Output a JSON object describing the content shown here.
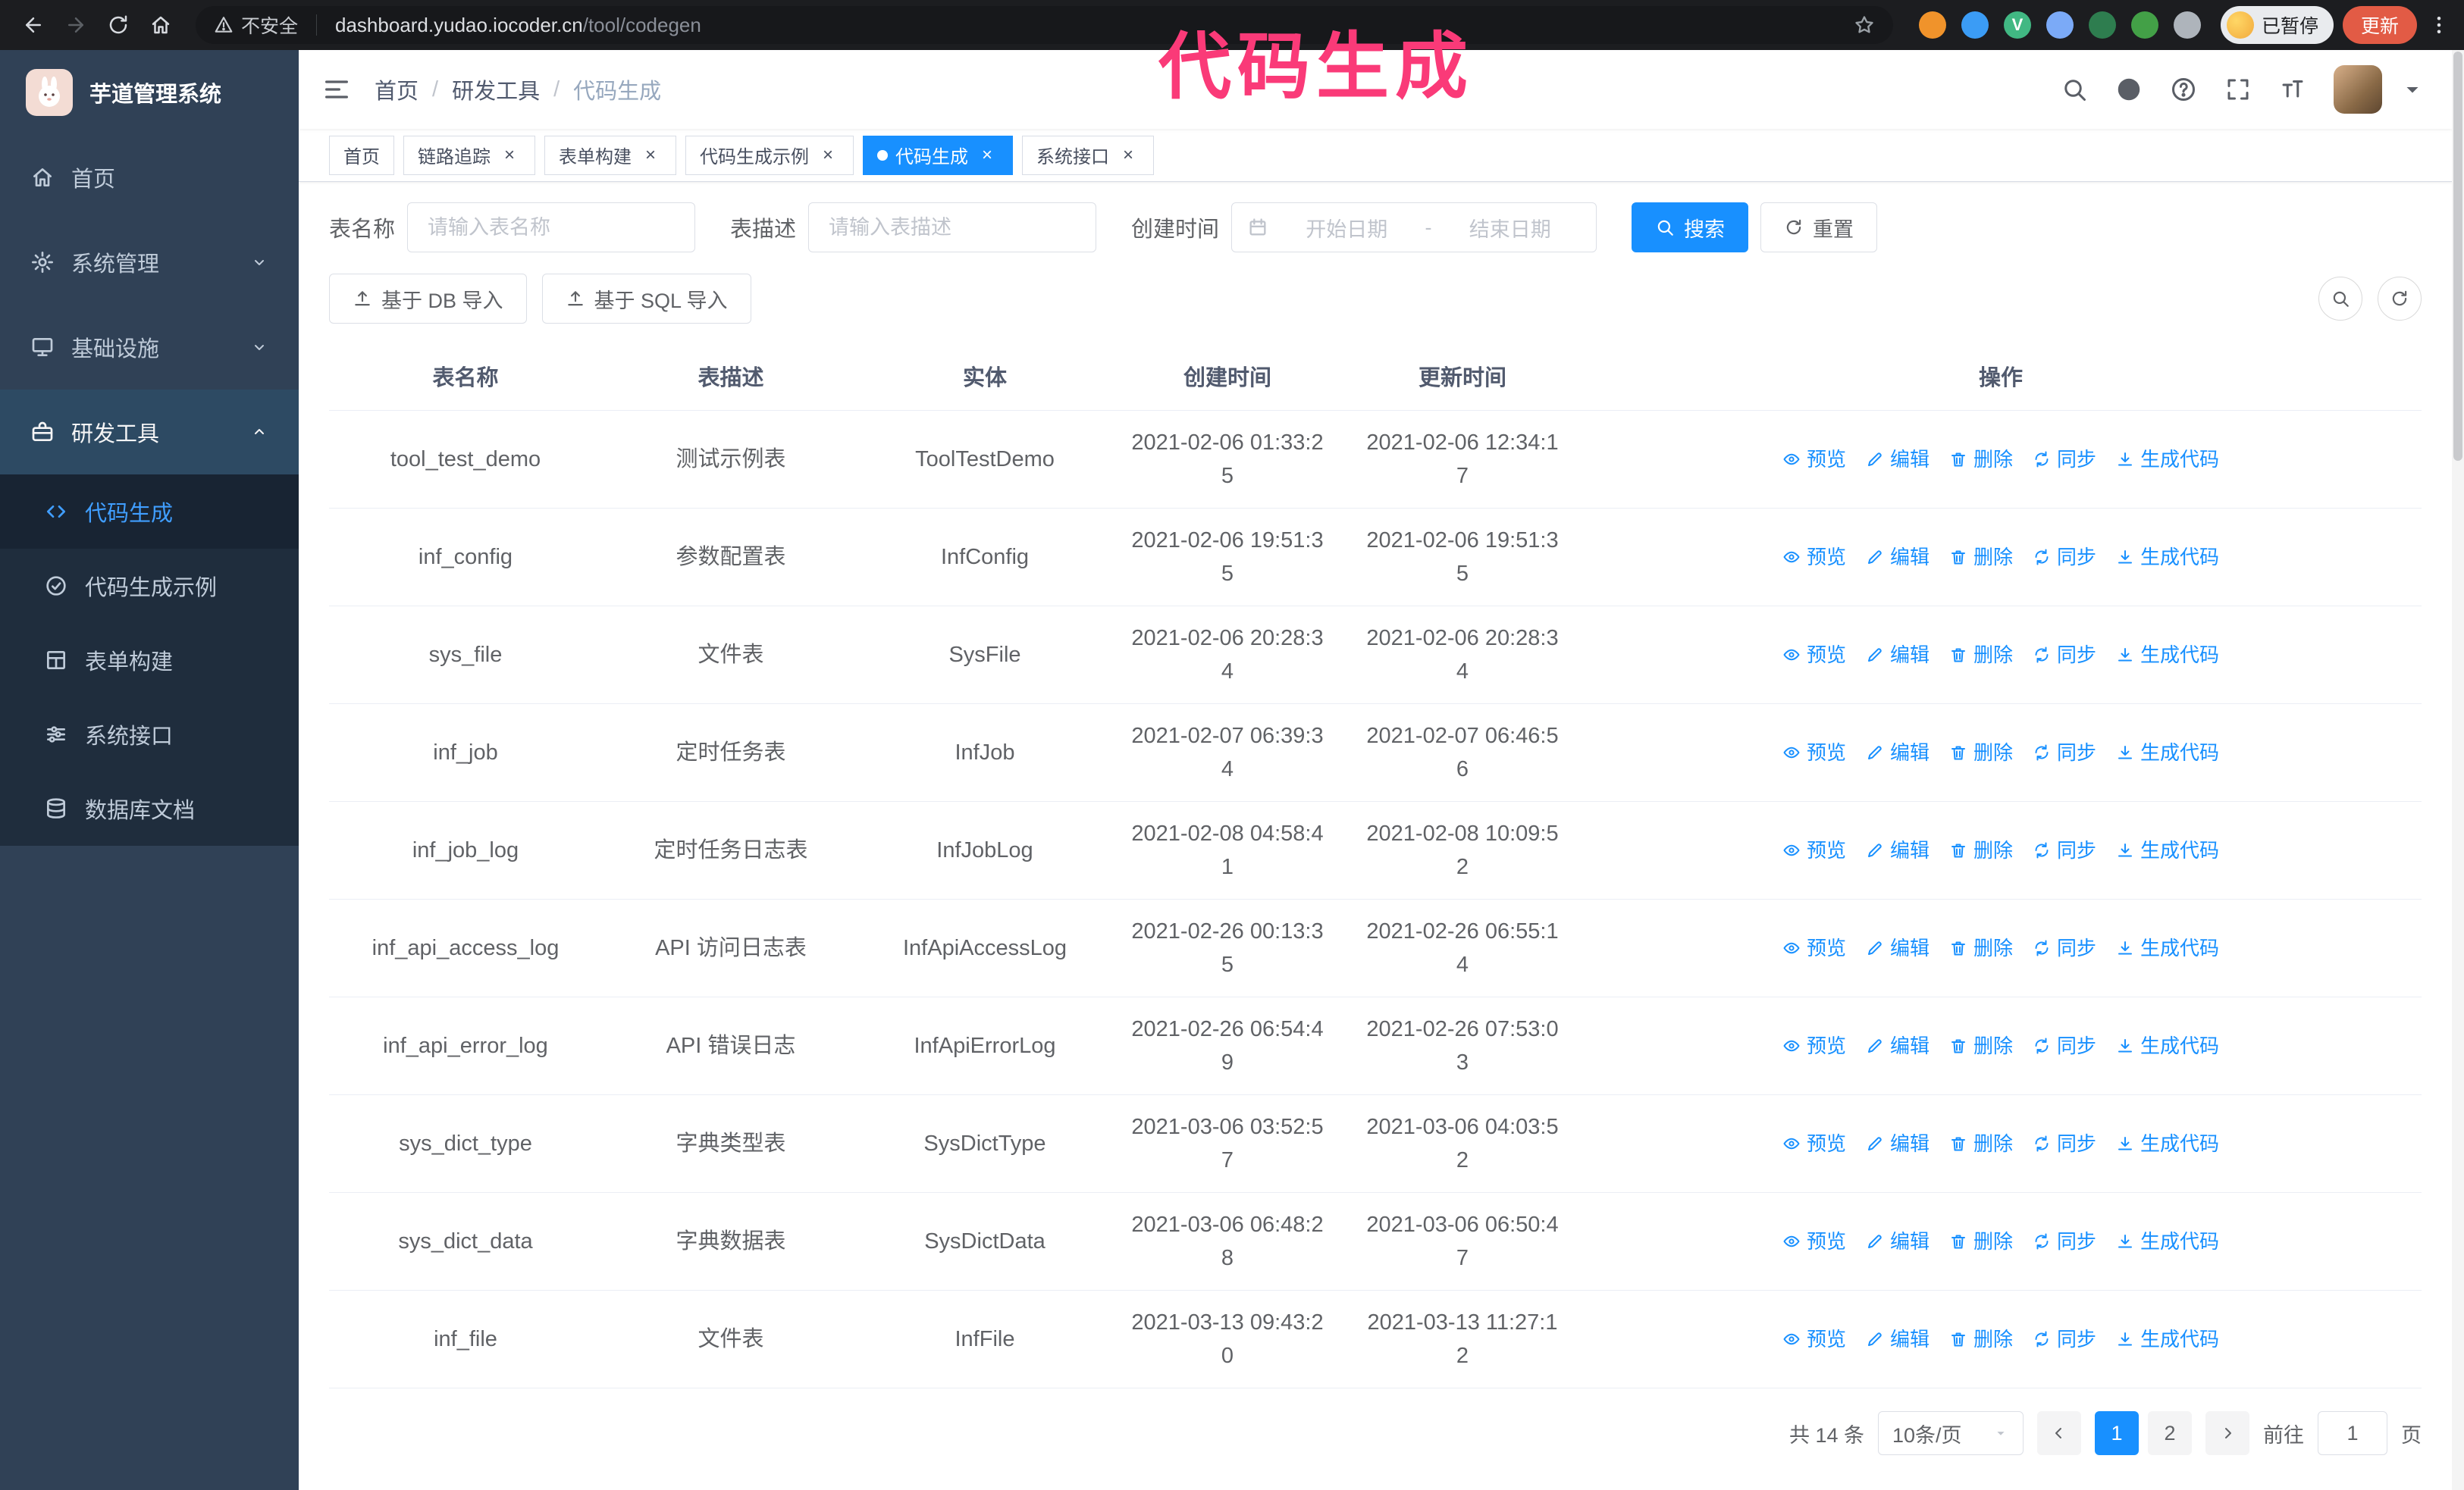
{
  "colors": {
    "accent": "#1890ff",
    "annotation_pink": "#fa3a78",
    "sidebar_bg": "#304156",
    "submenu_bg": "#1f2d3d",
    "active_menu_text": "#409eff",
    "update_button_bg": "#e25b45"
  },
  "annotation": "代码生成",
  "browser": {
    "security_label": "不安全",
    "url_domain": "dashboard.yudao.iocoder.cn",
    "url_path": "/tool/codegen",
    "profile_chip_label": "已暂停",
    "update_button_label": "更新",
    "extensions": [
      {
        "name": "duck-extension",
        "color": "#f0932b",
        "label": ""
      },
      {
        "name": "drop-extension",
        "color": "#3b9cf5",
        "label": ""
      },
      {
        "name": "vue-devtools",
        "color": "#41b883",
        "label": "V"
      },
      {
        "name": "people-extension",
        "color": "#7baaf7",
        "label": ""
      },
      {
        "name": "chart-extension",
        "color": "#2e7d4f",
        "label": ""
      },
      {
        "name": "leaf-extension",
        "color": "#43a047",
        "label": ""
      },
      {
        "name": "paw-extension",
        "color": "#aeb4bb",
        "label": ""
      }
    ]
  },
  "sidebar": {
    "app_title": "芋道管理系统",
    "items": [
      {
        "id": "home",
        "label": "首页",
        "icon": "home"
      },
      {
        "id": "system-mgmt",
        "label": "系统管理",
        "icon": "gear",
        "expand": "down"
      },
      {
        "id": "infrastructure",
        "label": "基础设施",
        "icon": "monitor",
        "expand": "down"
      },
      {
        "id": "dev-tools",
        "label": "研发工具",
        "icon": "tool",
        "expand": "up",
        "highlight": true,
        "children": [
          {
            "id": "codegen",
            "label": "代码生成",
            "icon": "code",
            "active": true
          },
          {
            "id": "codegen-example",
            "label": "代码生成示例",
            "icon": "badge"
          },
          {
            "id": "form-builder",
            "label": "表单构建",
            "icon": "form"
          },
          {
            "id": "system-api",
            "label": "系统接口",
            "icon": "api"
          },
          {
            "id": "db-doc",
            "label": "数据库文档",
            "icon": "db"
          }
        ]
      }
    ]
  },
  "breadcrumb": [
    "首页",
    "研发工具",
    "代码生成"
  ],
  "tabs": [
    {
      "label": "首页",
      "closable": false,
      "active": false
    },
    {
      "label": "链路追踪",
      "closable": true,
      "active": false
    },
    {
      "label": "表单构建",
      "closable": true,
      "active": false
    },
    {
      "label": "代码生成示例",
      "closable": true,
      "active": false
    },
    {
      "label": "代码生成",
      "closable": true,
      "active": true
    },
    {
      "label": "系统接口",
      "closable": true,
      "active": false
    }
  ],
  "filters": {
    "table_name_label": "表名称",
    "table_name_placeholder": "请输入表名称",
    "table_desc_label": "表描述",
    "table_desc_placeholder": "请输入表描述",
    "create_time_label": "创建时间",
    "start_date_placeholder": "开始日期",
    "range_separator": "-",
    "end_date_placeholder": "结束日期",
    "search_label": "搜索",
    "reset_label": "重置"
  },
  "toolbar": {
    "import_db_label": "基于 DB 导入",
    "import_sql_label": "基于 SQL 导入"
  },
  "table": {
    "columns": [
      "表名称",
      "表描述",
      "实体",
      "创建时间",
      "更新时间",
      "操作"
    ],
    "row_actions": [
      {
        "label": "预览",
        "icon": "eye"
      },
      {
        "label": "编辑",
        "icon": "edit"
      },
      {
        "label": "删除",
        "icon": "trash"
      },
      {
        "label": "同步",
        "icon": "sync"
      },
      {
        "label": "生成代码",
        "icon": "download"
      }
    ],
    "rows": [
      {
        "name": "tool_test_demo",
        "description": "测试示例表",
        "entity": "ToolTestDemo",
        "created": "2021-02-06 01:33:25",
        "updated": "2021-02-06 12:34:17"
      },
      {
        "name": "inf_config",
        "description": "参数配置表",
        "entity": "InfConfig",
        "created": "2021-02-06 19:51:35",
        "updated": "2021-02-06 19:51:35"
      },
      {
        "name": "sys_file",
        "description": "文件表",
        "entity": "SysFile",
        "created": "2021-02-06 20:28:34",
        "updated": "2021-02-06 20:28:34"
      },
      {
        "name": "inf_job",
        "description": "定时任务表",
        "entity": "InfJob",
        "created": "2021-02-07 06:39:34",
        "updated": "2021-02-07 06:46:56"
      },
      {
        "name": "inf_job_log",
        "description": "定时任务日志表",
        "entity": "InfJobLog",
        "created": "2021-02-08 04:58:41",
        "updated": "2021-02-08 10:09:52"
      },
      {
        "name": "inf_api_access_log",
        "description": "API 访问日志表",
        "entity": "InfApiAccessLog",
        "created": "2021-02-26 00:13:35",
        "updated": "2021-02-26 06:55:14"
      },
      {
        "name": "inf_api_error_log",
        "description": "API 错误日志",
        "entity": "InfApiErrorLog",
        "created": "2021-02-26 06:54:49",
        "updated": "2021-02-26 07:53:03"
      },
      {
        "name": "sys_dict_type",
        "description": "字典类型表",
        "entity": "SysDictType",
        "created": "2021-03-06 03:52:57",
        "updated": "2021-03-06 04:03:52"
      },
      {
        "name": "sys_dict_data",
        "description": "字典数据表",
        "entity": "SysDictData",
        "created": "2021-03-06 06:48:28",
        "updated": "2021-03-06 06:50:47"
      },
      {
        "name": "inf_file",
        "description": "文件表",
        "entity": "InfFile",
        "created": "2021-03-13 09:43:20",
        "updated": "2021-03-13 11:27:12"
      }
    ]
  },
  "pagination": {
    "total_label": "共 14 条",
    "page_size_label": "10条/页",
    "pages": [
      "1",
      "2"
    ],
    "active_page": "1",
    "goto_label": "前往",
    "goto_value": "1",
    "goto_unit_label": "页"
  }
}
